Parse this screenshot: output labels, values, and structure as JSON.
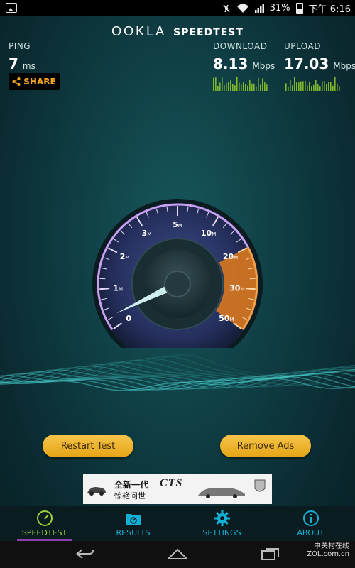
{
  "status_bar": {
    "battery_percent": "31%",
    "time": "下午 6:16",
    "icons": [
      "gallery-icon",
      "vibrate-off-icon",
      "wifi-icon",
      "signal-icon",
      "battery-icon"
    ]
  },
  "header": {
    "brand_ookla": "OOKLA",
    "brand_speedtest": "SPEEDTEST"
  },
  "results": {
    "ping_label": "PING",
    "ping_value": "7",
    "ping_unit": "ms",
    "download_label": "DOWNLOAD",
    "download_value": "8.13",
    "download_unit": "Mbps",
    "upload_label": "UPLOAD",
    "upload_value": "17.03",
    "upload_unit": "Mbps",
    "share_label": "SHARE"
  },
  "gauge": {
    "ticks": [
      "0",
      "1",
      "2",
      "3",
      "5",
      "10",
      "20",
      "30",
      "50"
    ],
    "tick_unit": "M",
    "needle_value_mbps": 0.3,
    "accent_purple": "#b27ae0",
    "accent_orange": "#e48a2a"
  },
  "buttons": {
    "restart_label": "Restart Test",
    "remove_ads_label": "Remove Ads"
  },
  "ad": {
    "line1": "全新一代",
    "model": "CTS",
    "line2": "惊艳问世"
  },
  "tabs": [
    {
      "label": "SPEEDTEST",
      "icon": "gauge-icon",
      "active": true
    },
    {
      "label": "RESULTS",
      "icon": "folder-gauge-icon",
      "active": false
    },
    {
      "label": "SETTINGS",
      "icon": "gear-icon",
      "active": false
    },
    {
      "label": "ABOUT",
      "icon": "info-icon",
      "active": false
    }
  ],
  "watermark": {
    "line1": "中关村在线",
    "line2": "ZOL.com.cn"
  },
  "colors": {
    "tab_active": "#9bd33a",
    "tab_inactive": "#12b0d6",
    "button_gold": "#f0b42e",
    "share_orange": "#f5a524"
  }
}
